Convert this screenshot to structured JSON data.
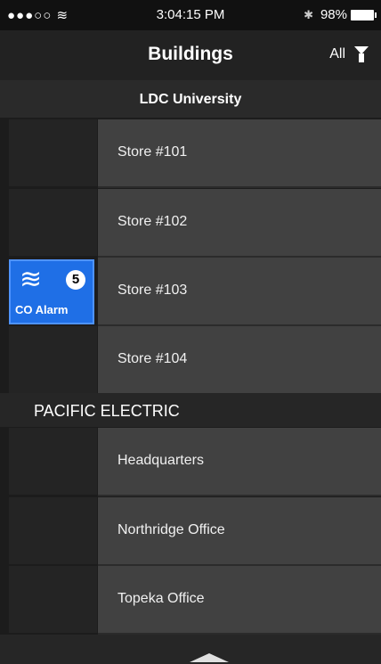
{
  "status_bar": {
    "signal": "●●●○○",
    "wifi": "≋",
    "time": "3:04:15 PM",
    "bluetooth": "✱",
    "battery": "98%"
  },
  "nav": {
    "title": "Buildings",
    "filter_label": "All",
    "filter_icon": "filter-icon"
  },
  "groups": [
    {
      "name": "LDC University",
      "items": [
        "Store #101",
        "Store #102",
        "Store #103",
        "Store #104"
      ]
    },
    {
      "name": "PACIFIC ELECTRIC",
      "items": [
        "Headquarters",
        "Northridge Office",
        "Topeka Office"
      ]
    }
  ],
  "alarm": {
    "icon": "gas-wave-icon",
    "count": "5",
    "label": "CO Alarm",
    "color": "#1f6fe6"
  },
  "footer": {
    "icon": "chevron-up-icon"
  }
}
